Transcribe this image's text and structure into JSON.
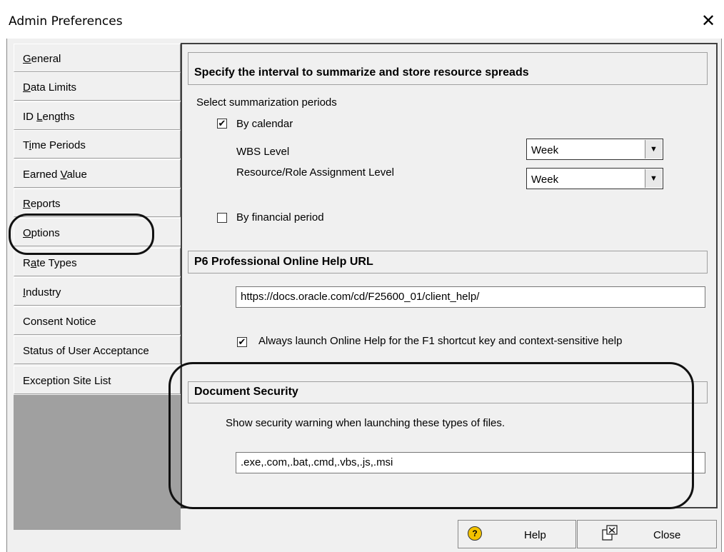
{
  "window": {
    "title": "Admin Preferences",
    "close_glyph": "✕"
  },
  "tabs": [
    {
      "label": "General",
      "key": "G"
    },
    {
      "label": "Data Limits",
      "key": "D"
    },
    {
      "label": "ID Lengths",
      "key": "L"
    },
    {
      "label": "Time Periods",
      "key": "i"
    },
    {
      "label": "Earned Value",
      "key": "V"
    },
    {
      "label": "Reports",
      "key": "R"
    },
    {
      "label": "Options",
      "key": "O"
    },
    {
      "label": "Rate Types",
      "key": "a"
    },
    {
      "label": "Industry",
      "key": "I"
    },
    {
      "label": "Consent Notice",
      "key": ""
    },
    {
      "label": "Status of User Acceptance",
      "key": ""
    },
    {
      "label": "Exception Site List",
      "key": ""
    }
  ],
  "active_tab": "Options",
  "summarize": {
    "heading": "Specify the interval to summarize and store resource spreads",
    "subheading": "Select summarization periods",
    "by_calendar_label": "By calendar",
    "by_calendar_checked": "✔",
    "wbs_label": "WBS Level",
    "wbs_value": "Week",
    "assignment_label": "Resource/Role Assignment Level",
    "assignment_value": "Week",
    "by_financial_label": "By financial period",
    "by_financial_checked": ""
  },
  "help_url": {
    "heading": "P6 Professional Online Help URL",
    "url": "https://docs.oracle.com/cd/F25600_01/client_help/",
    "always_launch_label": "Always launch Online Help for the F1 shortcut key and context-sensitive help",
    "always_launch_checked": "✔"
  },
  "doc_security": {
    "heading": "Document Security",
    "description": "Show security warning when launching these types of files.",
    "file_types": ".exe,.com,.bat,.cmd,.vbs,.js,.msi"
  },
  "buttons": {
    "help_label": "Help",
    "help_icon_glyph": "?",
    "close_label": "Close"
  },
  "colors": {
    "help_icon_bg": "#f2c200",
    "highlight_ring": "#111111"
  }
}
